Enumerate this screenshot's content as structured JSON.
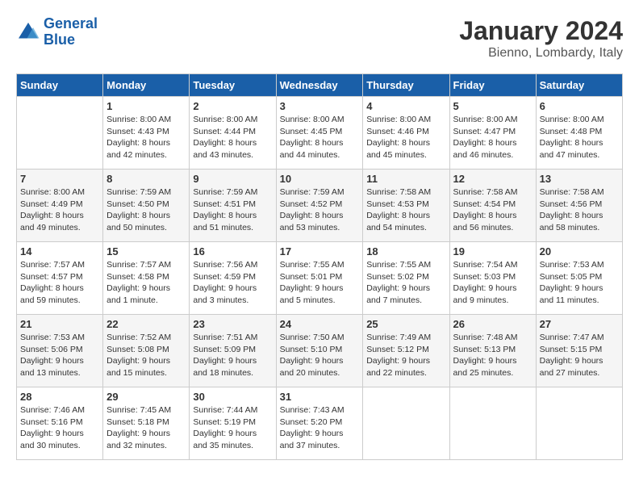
{
  "header": {
    "logo_general": "General",
    "logo_blue": "Blue",
    "month": "January 2024",
    "location": "Bienno, Lombardy, Italy"
  },
  "weekdays": [
    "Sunday",
    "Monday",
    "Tuesday",
    "Wednesday",
    "Thursday",
    "Friday",
    "Saturday"
  ],
  "weeks": [
    [
      {
        "day": "",
        "sunrise": "",
        "sunset": "",
        "daylight": ""
      },
      {
        "day": "1",
        "sunrise": "Sunrise: 8:00 AM",
        "sunset": "Sunset: 4:43 PM",
        "daylight": "Daylight: 8 hours and 42 minutes."
      },
      {
        "day": "2",
        "sunrise": "Sunrise: 8:00 AM",
        "sunset": "Sunset: 4:44 PM",
        "daylight": "Daylight: 8 hours and 43 minutes."
      },
      {
        "day": "3",
        "sunrise": "Sunrise: 8:00 AM",
        "sunset": "Sunset: 4:45 PM",
        "daylight": "Daylight: 8 hours and 44 minutes."
      },
      {
        "day": "4",
        "sunrise": "Sunrise: 8:00 AM",
        "sunset": "Sunset: 4:46 PM",
        "daylight": "Daylight: 8 hours and 45 minutes."
      },
      {
        "day": "5",
        "sunrise": "Sunrise: 8:00 AM",
        "sunset": "Sunset: 4:47 PM",
        "daylight": "Daylight: 8 hours and 46 minutes."
      },
      {
        "day": "6",
        "sunrise": "Sunrise: 8:00 AM",
        "sunset": "Sunset: 4:48 PM",
        "daylight": "Daylight: 8 hours and 47 minutes."
      }
    ],
    [
      {
        "day": "7",
        "sunrise": "Sunrise: 8:00 AM",
        "sunset": "Sunset: 4:49 PM",
        "daylight": "Daylight: 8 hours and 49 minutes."
      },
      {
        "day": "8",
        "sunrise": "Sunrise: 7:59 AM",
        "sunset": "Sunset: 4:50 PM",
        "daylight": "Daylight: 8 hours and 50 minutes."
      },
      {
        "day": "9",
        "sunrise": "Sunrise: 7:59 AM",
        "sunset": "Sunset: 4:51 PM",
        "daylight": "Daylight: 8 hours and 51 minutes."
      },
      {
        "day": "10",
        "sunrise": "Sunrise: 7:59 AM",
        "sunset": "Sunset: 4:52 PM",
        "daylight": "Daylight: 8 hours and 53 minutes."
      },
      {
        "day": "11",
        "sunrise": "Sunrise: 7:58 AM",
        "sunset": "Sunset: 4:53 PM",
        "daylight": "Daylight: 8 hours and 54 minutes."
      },
      {
        "day": "12",
        "sunrise": "Sunrise: 7:58 AM",
        "sunset": "Sunset: 4:54 PM",
        "daylight": "Daylight: 8 hours and 56 minutes."
      },
      {
        "day": "13",
        "sunrise": "Sunrise: 7:58 AM",
        "sunset": "Sunset: 4:56 PM",
        "daylight": "Daylight: 8 hours and 58 minutes."
      }
    ],
    [
      {
        "day": "14",
        "sunrise": "Sunrise: 7:57 AM",
        "sunset": "Sunset: 4:57 PM",
        "daylight": "Daylight: 8 hours and 59 minutes."
      },
      {
        "day": "15",
        "sunrise": "Sunrise: 7:57 AM",
        "sunset": "Sunset: 4:58 PM",
        "daylight": "Daylight: 9 hours and 1 minute."
      },
      {
        "day": "16",
        "sunrise": "Sunrise: 7:56 AM",
        "sunset": "Sunset: 4:59 PM",
        "daylight": "Daylight: 9 hours and 3 minutes."
      },
      {
        "day": "17",
        "sunrise": "Sunrise: 7:55 AM",
        "sunset": "Sunset: 5:01 PM",
        "daylight": "Daylight: 9 hours and 5 minutes."
      },
      {
        "day": "18",
        "sunrise": "Sunrise: 7:55 AM",
        "sunset": "Sunset: 5:02 PM",
        "daylight": "Daylight: 9 hours and 7 minutes."
      },
      {
        "day": "19",
        "sunrise": "Sunrise: 7:54 AM",
        "sunset": "Sunset: 5:03 PM",
        "daylight": "Daylight: 9 hours and 9 minutes."
      },
      {
        "day": "20",
        "sunrise": "Sunrise: 7:53 AM",
        "sunset": "Sunset: 5:05 PM",
        "daylight": "Daylight: 9 hours and 11 minutes."
      }
    ],
    [
      {
        "day": "21",
        "sunrise": "Sunrise: 7:53 AM",
        "sunset": "Sunset: 5:06 PM",
        "daylight": "Daylight: 9 hours and 13 minutes."
      },
      {
        "day": "22",
        "sunrise": "Sunrise: 7:52 AM",
        "sunset": "Sunset: 5:08 PM",
        "daylight": "Daylight: 9 hours and 15 minutes."
      },
      {
        "day": "23",
        "sunrise": "Sunrise: 7:51 AM",
        "sunset": "Sunset: 5:09 PM",
        "daylight": "Daylight: 9 hours and 18 minutes."
      },
      {
        "day": "24",
        "sunrise": "Sunrise: 7:50 AM",
        "sunset": "Sunset: 5:10 PM",
        "daylight": "Daylight: 9 hours and 20 minutes."
      },
      {
        "day": "25",
        "sunrise": "Sunrise: 7:49 AM",
        "sunset": "Sunset: 5:12 PM",
        "daylight": "Daylight: 9 hours and 22 minutes."
      },
      {
        "day": "26",
        "sunrise": "Sunrise: 7:48 AM",
        "sunset": "Sunset: 5:13 PM",
        "daylight": "Daylight: 9 hours and 25 minutes."
      },
      {
        "day": "27",
        "sunrise": "Sunrise: 7:47 AM",
        "sunset": "Sunset: 5:15 PM",
        "daylight": "Daylight: 9 hours and 27 minutes."
      }
    ],
    [
      {
        "day": "28",
        "sunrise": "Sunrise: 7:46 AM",
        "sunset": "Sunset: 5:16 PM",
        "daylight": "Daylight: 9 hours and 30 minutes."
      },
      {
        "day": "29",
        "sunrise": "Sunrise: 7:45 AM",
        "sunset": "Sunset: 5:18 PM",
        "daylight": "Daylight: 9 hours and 32 minutes."
      },
      {
        "day": "30",
        "sunrise": "Sunrise: 7:44 AM",
        "sunset": "Sunset: 5:19 PM",
        "daylight": "Daylight: 9 hours and 35 minutes."
      },
      {
        "day": "31",
        "sunrise": "Sunrise: 7:43 AM",
        "sunset": "Sunset: 5:20 PM",
        "daylight": "Daylight: 9 hours and 37 minutes."
      },
      {
        "day": "",
        "sunrise": "",
        "sunset": "",
        "daylight": ""
      },
      {
        "day": "",
        "sunrise": "",
        "sunset": "",
        "daylight": ""
      },
      {
        "day": "",
        "sunrise": "",
        "sunset": "",
        "daylight": ""
      }
    ]
  ]
}
